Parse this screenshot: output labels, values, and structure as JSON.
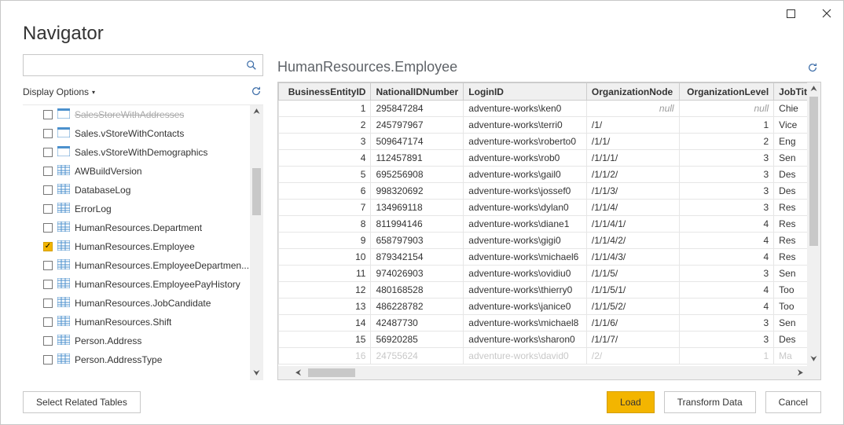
{
  "window": {
    "title": "Navigator",
    "display_options_label": "Display Options"
  },
  "search": {
    "placeholder": ""
  },
  "preview": {
    "title": "HumanResources.Employee"
  },
  "tree": {
    "items": [
      {
        "label": "SalesStoreWithAddresses",
        "type": "view",
        "checked": false,
        "faded": true
      },
      {
        "label": "Sales.vStoreWithContacts",
        "type": "view",
        "checked": false
      },
      {
        "label": "Sales.vStoreWithDemographics",
        "type": "view",
        "checked": false
      },
      {
        "label": "AWBuildVersion",
        "type": "table",
        "checked": false
      },
      {
        "label": "DatabaseLog",
        "type": "table",
        "checked": false
      },
      {
        "label": "ErrorLog",
        "type": "table",
        "checked": false
      },
      {
        "label": "HumanResources.Department",
        "type": "table",
        "checked": false
      },
      {
        "label": "HumanResources.Employee",
        "type": "table",
        "checked": true,
        "selected": true
      },
      {
        "label": "HumanResources.EmployeeDepartmen...",
        "type": "table",
        "checked": false
      },
      {
        "label": "HumanResources.EmployeePayHistory",
        "type": "table",
        "checked": false
      },
      {
        "label": "HumanResources.JobCandidate",
        "type": "table",
        "checked": false
      },
      {
        "label": "HumanResources.Shift",
        "type": "table",
        "checked": false
      },
      {
        "label": "Person.Address",
        "type": "table",
        "checked": false
      },
      {
        "label": "Person.AddressType",
        "type": "table",
        "checked": false
      }
    ]
  },
  "columns": [
    "BusinessEntityID",
    "NationalIDNumber",
    "LoginID",
    "OrganizationNode",
    "OrganizationLevel",
    "JobTitle"
  ],
  "rows": [
    {
      "bid": "1",
      "nid": "295847284",
      "login": "adventure-works\\ken0",
      "node": "null",
      "level": "null",
      "job": "Chie"
    },
    {
      "bid": "2",
      "nid": "245797967",
      "login": "adventure-works\\terri0",
      "node": "/1/",
      "level": "1",
      "job": "Vice"
    },
    {
      "bid": "3",
      "nid": "509647174",
      "login": "adventure-works\\roberto0",
      "node": "/1/1/",
      "level": "2",
      "job": "Eng"
    },
    {
      "bid": "4",
      "nid": "112457891",
      "login": "adventure-works\\rob0",
      "node": "/1/1/1/",
      "level": "3",
      "job": "Sen"
    },
    {
      "bid": "5",
      "nid": "695256908",
      "login": "adventure-works\\gail0",
      "node": "/1/1/2/",
      "level": "3",
      "job": "Des"
    },
    {
      "bid": "6",
      "nid": "998320692",
      "login": "adventure-works\\jossef0",
      "node": "/1/1/3/",
      "level": "3",
      "job": "Des"
    },
    {
      "bid": "7",
      "nid": "134969118",
      "login": "adventure-works\\dylan0",
      "node": "/1/1/4/",
      "level": "3",
      "job": "Res"
    },
    {
      "bid": "8",
      "nid": "811994146",
      "login": "adventure-works\\diane1",
      "node": "/1/1/4/1/",
      "level": "4",
      "job": "Res"
    },
    {
      "bid": "9",
      "nid": "658797903",
      "login": "adventure-works\\gigi0",
      "node": "/1/1/4/2/",
      "level": "4",
      "job": "Res"
    },
    {
      "bid": "10",
      "nid": "879342154",
      "login": "adventure-works\\michael6",
      "node": "/1/1/4/3/",
      "level": "4",
      "job": "Res"
    },
    {
      "bid": "11",
      "nid": "974026903",
      "login": "adventure-works\\ovidiu0",
      "node": "/1/1/5/",
      "level": "3",
      "job": "Sen"
    },
    {
      "bid": "12",
      "nid": "480168528",
      "login": "adventure-works\\thierry0",
      "node": "/1/1/5/1/",
      "level": "4",
      "job": "Too"
    },
    {
      "bid": "13",
      "nid": "486228782",
      "login": "adventure-works\\janice0",
      "node": "/1/1/5/2/",
      "level": "4",
      "job": "Too"
    },
    {
      "bid": "14",
      "nid": "42487730",
      "login": "adventure-works\\michael8",
      "node": "/1/1/6/",
      "level": "3",
      "job": "Sen"
    },
    {
      "bid": "15",
      "nid": "56920285",
      "login": "adventure-works\\sharon0",
      "node": "/1/1/7/",
      "level": "3",
      "job": "Des"
    },
    {
      "bid": "16",
      "nid": "24755624",
      "login": "adventure-works\\david0",
      "node": "/2/",
      "level": "1",
      "job": "Ma",
      "faded": true
    }
  ],
  "footer": {
    "select_related": "Select Related Tables",
    "load": "Load",
    "transform": "Transform Data",
    "cancel": "Cancel"
  }
}
